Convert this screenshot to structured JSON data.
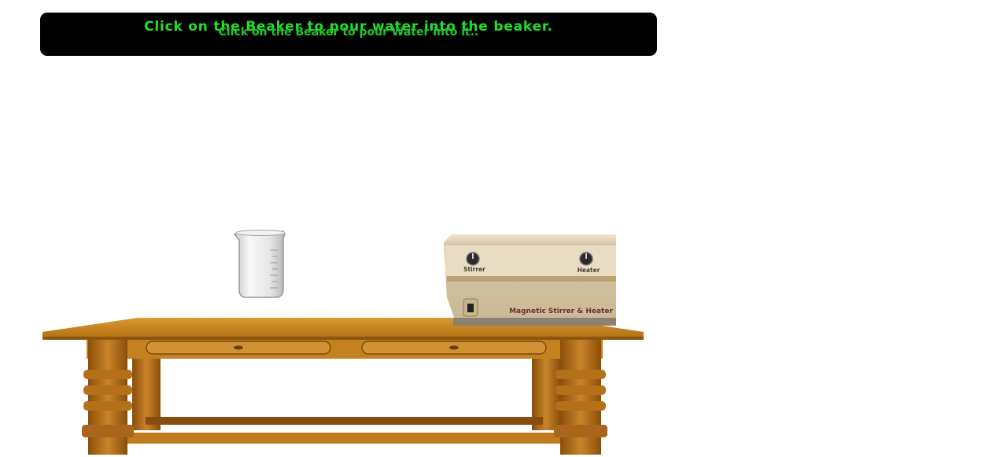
{
  "instructions": {
    "primary": "Click on the Beaker to pour water into the beaker.",
    "secondary": "Click on the Beaker to pour Water into it.."
  },
  "device": {
    "label": "Magnetic Stirrer & Heater",
    "knob1": "Stirrer",
    "knob2": "Heater"
  },
  "colors": {
    "banner_bg": "#000000",
    "banner_text": "#22e02a",
    "table_wood": "#b7791a",
    "device_body": "#d9cbb0"
  }
}
